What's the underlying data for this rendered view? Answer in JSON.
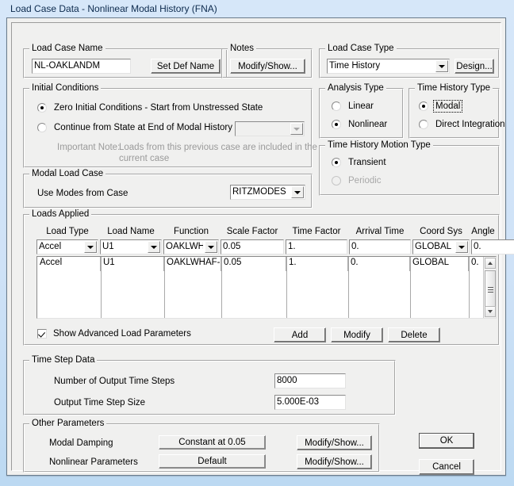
{
  "window": {
    "title": "Load Case Data - Nonlinear Modal History (FNA)"
  },
  "load_case_name": {
    "group_title": "Load Case Name",
    "value": "NL-OAKLANDM",
    "set_def_name_button": "Set Def Name"
  },
  "notes": {
    "group_title": "Notes",
    "modify_show_button": "Modify/Show..."
  },
  "load_case_type": {
    "group_title": "Load Case Type",
    "selected": "Time History",
    "design_button": "Design...",
    "design_button_accel": "g"
  },
  "initial_conditions": {
    "group_title": "Initial Conditions",
    "zero_option": "Zero Initial Conditions - Start from Unstressed State",
    "zero_selected": true,
    "continue_option": "Continue from State at End of Modal History",
    "continue_selected": false,
    "continue_case_value": "",
    "note_label": "Important Note:",
    "note_line1": "Loads from this previous case are included in the",
    "note_line2": "current case"
  },
  "analysis_type": {
    "group_title": "Analysis Type",
    "linear": "Linear",
    "nonlinear": "Nonlinear",
    "selected": "Nonlinear"
  },
  "time_history_type": {
    "group_title": "Time History Type",
    "modal": "Modal",
    "direct_integration": "Direct Integration",
    "selected": "Modal"
  },
  "time_history_motion_type": {
    "group_title": "Time History Motion Type",
    "transient": "Transient",
    "periodic": "Periodic",
    "selected": "Transient",
    "periodic_enabled": false
  },
  "modal_load_case": {
    "group_title": "Modal Load Case",
    "label": "Use Modes from Case",
    "value": "RITZMODES"
  },
  "loads_applied": {
    "group_title": "Loads Applied",
    "columns": [
      "Load Type",
      "Load Name",
      "Function",
      "Scale Factor",
      "Time Factor",
      "Arrival Time",
      "Coord Sys",
      "Angle"
    ],
    "edit_row": {
      "load_type": "Accel",
      "load_name": "U1",
      "function": "OAKLWH.",
      "scale_factor": "0.05",
      "time_factor": "1.",
      "arrival_time": "0.",
      "coord_sys": "GLOBAL",
      "angle": "0."
    },
    "rows": [
      {
        "load_type": "Accel",
        "load_name": "U1",
        "function": "OAKLWHAF-",
        "scale_factor": "0.05",
        "time_factor": "1.",
        "arrival_time": "0.",
        "coord_sys": "GLOBAL",
        "angle": "0."
      }
    ],
    "show_advanced_label": "Show Advanced Load Parameters",
    "show_advanced_checked": true,
    "add_button": "Add",
    "modify_button": "Modify",
    "delete_button": "Delete"
  },
  "time_step_data": {
    "group_title": "Time Step Data",
    "num_steps_label": "Number of Output Time Steps",
    "num_steps_value": "8000",
    "step_size_label": "Output Time Step Size",
    "step_size_value": "5.000E-03"
  },
  "other_parameters": {
    "group_title": "Other Parameters",
    "modal_damping_label": "Modal Damping",
    "modal_damping_value": "Constant at 0.05",
    "modal_damping_button": "Modify/Show...",
    "nonlinear_params_label": "Nonlinear Parameters",
    "nonlinear_params_value": "Default",
    "nonlinear_params_button": "Modify/Show..."
  },
  "footer": {
    "ok_button": "OK",
    "cancel_button": "Cancel"
  }
}
